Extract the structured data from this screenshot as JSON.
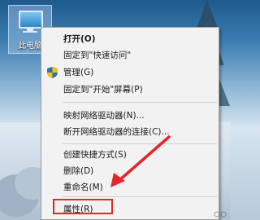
{
  "desktop": {
    "icon_label": "此电脑"
  },
  "context_menu": {
    "items": [
      {
        "label": "打开(O)"
      },
      {
        "label": "固定到\"快速访问\""
      },
      {
        "label": "管理(G)"
      },
      {
        "label": "固定到\"开始\"屏幕(P)"
      },
      {
        "label": "映射网络驱动器(N)..."
      },
      {
        "label": "断开网络驱动器的连接(C)..."
      },
      {
        "label": "创建快捷方式(S)"
      },
      {
        "label": "删除(D)"
      },
      {
        "label": "重命名(M)"
      },
      {
        "label": "属性(R)"
      }
    ]
  },
  "annotation": {
    "arrow_color": "#e3262a",
    "highlight_color": "#e3262a"
  }
}
